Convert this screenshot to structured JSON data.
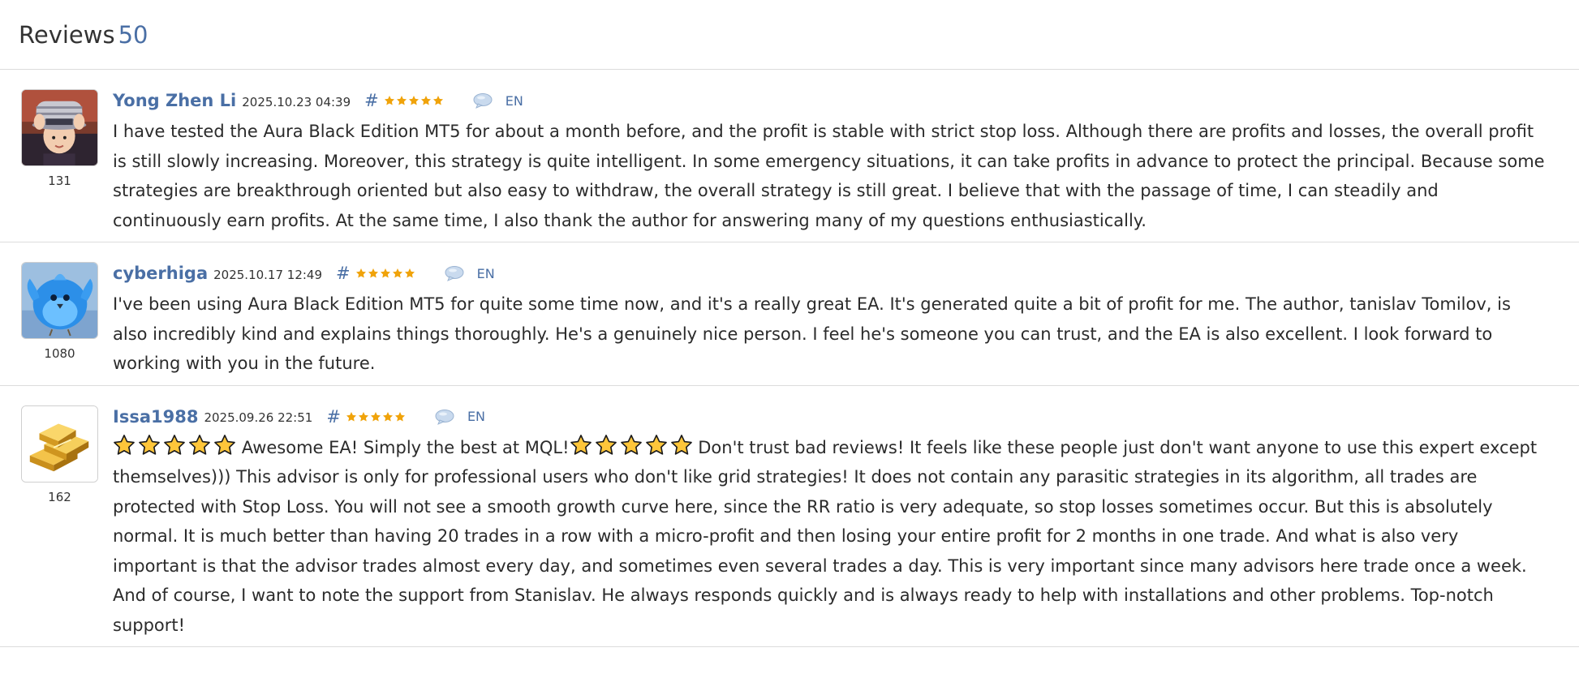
{
  "header": {
    "title": "Reviews",
    "count": "50"
  },
  "reviews": [
    {
      "author": "Yong Zhen Li",
      "avatar": "child-with-hat-avatar",
      "rating_number": "131",
      "date": "2025.10.23 04:39",
      "hash": "#",
      "stars": 5,
      "comment_icon": "speech-bubble-icon",
      "lang": "EN",
      "text": "I have tested the Aura Black Edition MT5 for about a month before, and the profit is stable with strict stop loss. Although there are profits and losses, the overall profit is still slowly increasing. Moreover, this strategy is quite intelligent. In some emergency situations, it can take profits in advance to protect the principal. Because some strategies are breakthrough oriented but also easy to withdraw, the overall strategy is still great. I believe that with the passage of time, I can steadily and continuously earn profits. At the same time, I also thank the author for answering many of my questions enthusiastically."
    },
    {
      "author": "cyberhiga",
      "avatar": "blue-bird-avatar",
      "rating_number": "1080",
      "date": "2025.10.17 12:49",
      "hash": "#",
      "stars": 5,
      "comment_icon": "speech-bubble-icon",
      "lang": "EN",
      "text": "I've been using Aura Black Edition MT5 for quite some time now, and it's a really great EA. It's generated quite a bit of profit for me. The author, tanislav Tomilov, is also incredibly kind and explains things thoroughly. He's a genuinely nice person. I feel he's someone you can trust, and the EA is also excellent. I look forward to working with you in the future."
    },
    {
      "author": "Issa1988",
      "avatar": "gold-bars-avatar",
      "rating_number": "162",
      "date": "2025.09.26 22:51",
      "hash": "#",
      "stars": 5,
      "comment_icon": "speech-bubble-icon",
      "lang": "EN",
      "text_part1": "Awesome EA! Simply the best at MQL!",
      "text_part2": "Don't trust bad reviews! It feels like these people just don't want anyone to use this expert except themselves))) This advisor is only for professional users who don't like grid strategies! It does not contain any parasitic strategies in its algorithm, all trades are protected with Stop Loss. You will not see a smooth growth curve here, since the RR ratio is very adequate, so stop losses sometimes occur. But this is absolutely normal. It is much better than having 20 trades in a row with a micro-profit and then losing your entire profit for 2 months in one trade. And what is also very important is that the advisor trades almost every day, and sometimes even several trades a day. This is very important since many advisors here trade once a week. And of course, I want to note the support from Stanislav. He always responds quickly and is always ready to help with installations and other problems. Top-notch support!"
    }
  ],
  "colors": {
    "accent": "#4a6fa5",
    "star": "#f0a30a",
    "text": "#2b2b2b",
    "divider": "#dcdcdc"
  }
}
